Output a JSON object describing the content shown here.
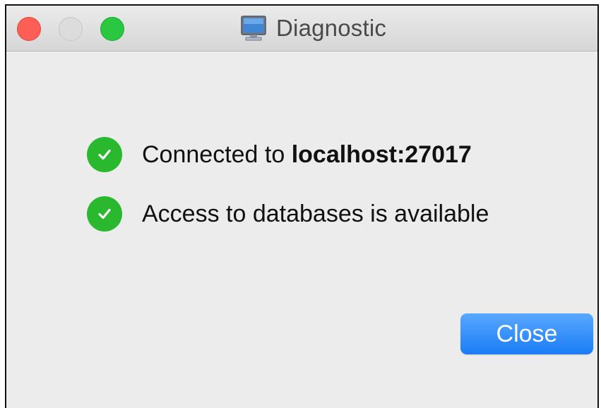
{
  "window": {
    "title": "Diagnostic",
    "title_icon": "monitor-icon",
    "controls": [
      "close",
      "minimize",
      "zoom"
    ]
  },
  "status": {
    "items": [
      {
        "icon": "checkmark-icon",
        "prefix": "Connected to ",
        "bold": "localhost:27017"
      },
      {
        "icon": "checkmark-icon",
        "text": "Access to databases is available"
      }
    ]
  },
  "actions": {
    "close_label": "Close"
  },
  "colors": {
    "success": "#2ab82e",
    "primary_button": "#1a7cf5",
    "close_light": "#fd5f57",
    "zoom_light": "#2ac840"
  }
}
